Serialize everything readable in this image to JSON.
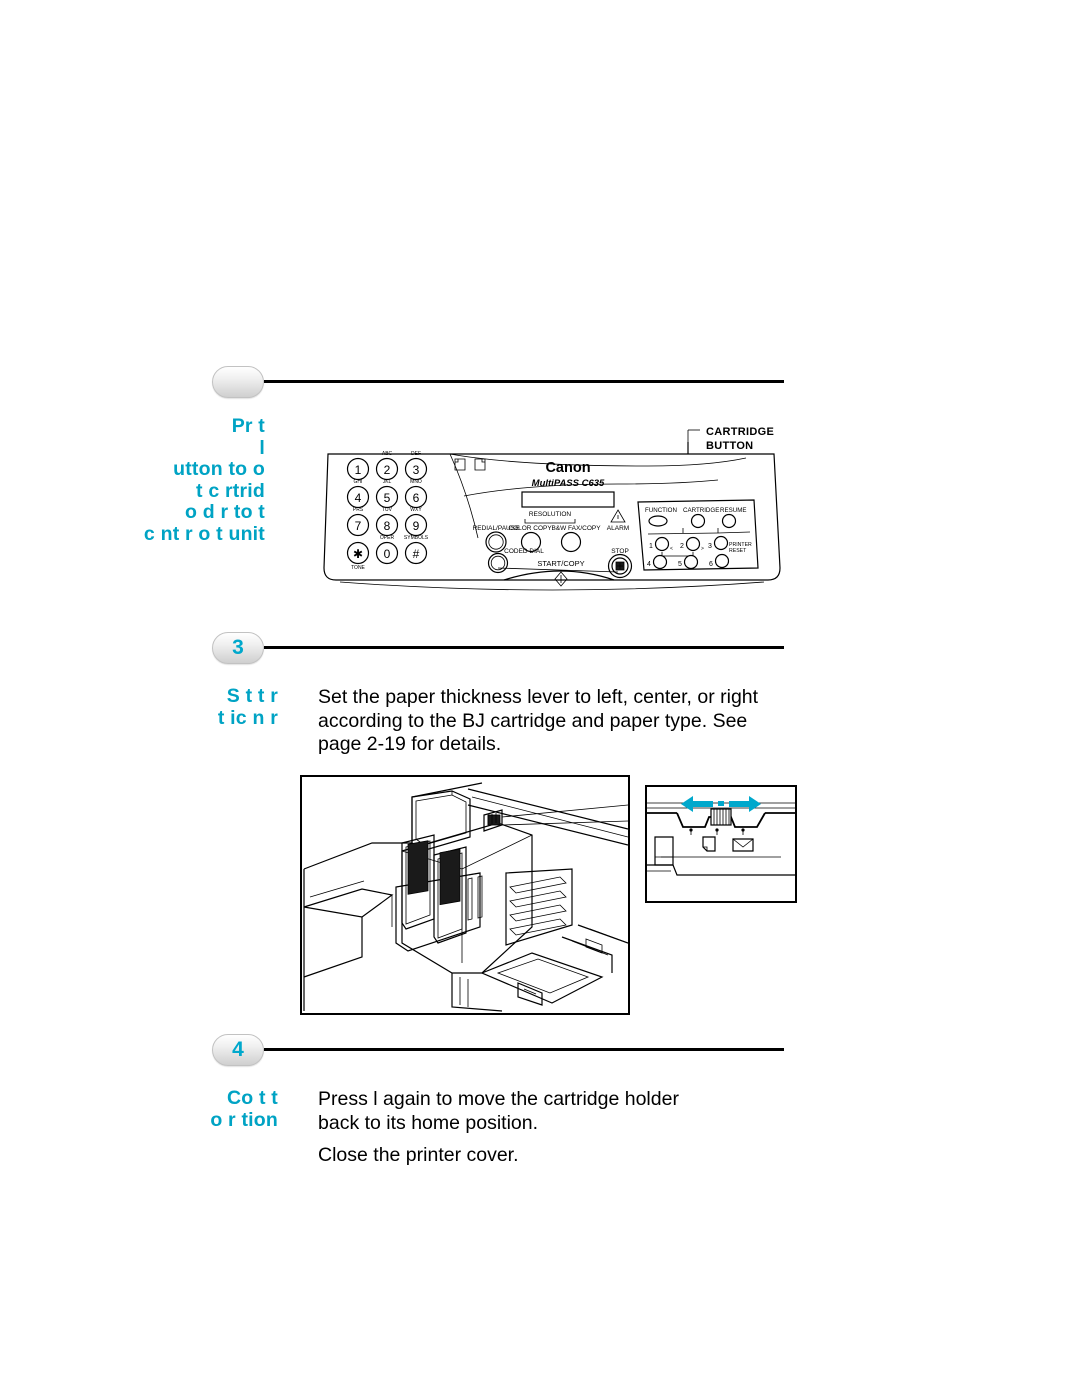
{
  "page": {
    "background": "#ffffff",
    "accent_color": "#00a3c4",
    "text_color": "#000000"
  },
  "steps": [
    {
      "number": "",
      "label": "Pr        t\n          l\nutton to    o\n t     c rtrid\n     o d  r to t\nc nt r o t    unit",
      "body": ""
    },
    {
      "number": "3",
      "label": "S t t            r\nt ic n          r",
      "body": "Set the paper thickness lever to left, center, or right\naccording to the BJ cartridge and paper type. See\npage 2-19 for details."
    },
    {
      "number": "4",
      "label": "Co      t t\n   o   r tion",
      "body": "Press      l        again to move the cartridge holder\nback to its home position.",
      "body2": "Close the printer cover."
    }
  ],
  "control_panel": {
    "callout": "CARTRIDGE\nBUTTON",
    "brand": "Canon",
    "model": "MultiPASS C635",
    "keypad": [
      {
        "key": "1",
        "letters": ""
      },
      {
        "key": "2",
        "letters": "ABC"
      },
      {
        "key": "3",
        "letters": "DEF"
      },
      {
        "key": "4",
        "letters": "GHI"
      },
      {
        "key": "5",
        "letters": "JKL"
      },
      {
        "key": "6",
        "letters": "MNO"
      },
      {
        "key": "7",
        "letters": "PRS"
      },
      {
        "key": "8",
        "letters": "TUV"
      },
      {
        "key": "9",
        "letters": "WXY"
      },
      {
        "key": "✱",
        "letters": ""
      },
      {
        "key": "0",
        "letters": "OPER"
      },
      {
        "key": "#",
        "letters": "SYMBOLS"
      }
    ],
    "keypad_bottom_label": "TONE",
    "labels": {
      "redial_pause": "REDIAL/PAUSE",
      "coded_dial": "CODED DIAL",
      "resolution": "RESOLUTION",
      "color_copy": "COLOR COPY",
      "bw_fax_copy": "B&W FAX/COPY",
      "alarm": "ALARM",
      "stop": "STOP",
      "start_copy": "START/COPY"
    },
    "right_block": {
      "function": "FUNCTION",
      "cartridge": "CARTRIDGE",
      "resume": "RESUME",
      "printer_reset": "PRINTER\nRESET",
      "numbers": [
        "1",
        "2",
        "3",
        "4",
        "5",
        "6"
      ]
    }
  },
  "illustration": {
    "main_alt": "printer interior with cartridge holder and two BJ cartridges",
    "inset_alt": "paper thickness lever detail with left-right arrows",
    "arrow_color": "#00a8cc"
  }
}
